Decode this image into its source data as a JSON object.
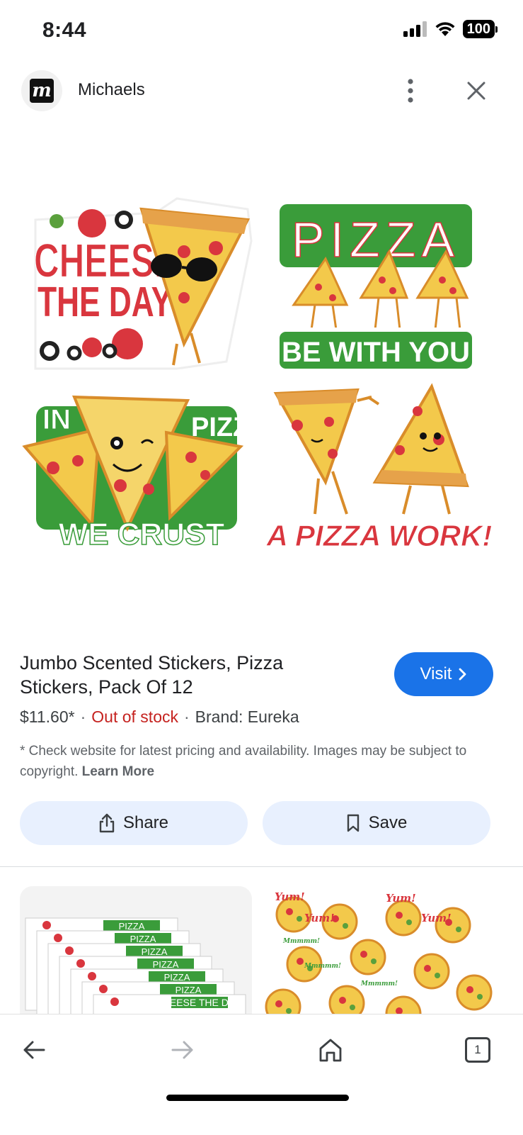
{
  "status_bar": {
    "time": "8:44",
    "battery": "100"
  },
  "header": {
    "site_name": "Michaels",
    "logo_letter": "m"
  },
  "hero": {
    "stickers": [
      {
        "lines": [
          "CHEESE",
          "THE DAY!"
        ],
        "color": "#d9363e"
      },
      {
        "top": "PIZZA",
        "bottom": "BE WITH YOU",
        "color": "#3a9c3a"
      },
      {
        "lines": [
          "IN",
          "PIZZA",
          "WE CRUST"
        ],
        "color": "#3a9c3a"
      },
      {
        "lines": [
          "A PIZZA WORK!"
        ],
        "color": "#d9363e"
      }
    ]
  },
  "product": {
    "title": "Jumbo Scented Stickers, Pizza Stickers, Pack Of 12",
    "price": "$11.60*",
    "stock": "Out of stock",
    "brand": "Brand: Eureka",
    "disclaimer": "* Check website for latest pricing and availability. Images may be subject to copyright.",
    "learn_more": "Learn More",
    "visit_label": "Visit"
  },
  "actions": {
    "share_label": "Share",
    "save_label": "Save"
  },
  "related": {
    "left_labels": [
      "PIZZA",
      "PIZZA",
      "PIZZA",
      "PIZZA",
      "PIZZA",
      "PIZZA",
      "CHEESE THE DAY!"
    ],
    "right_labels": [
      "Yum!",
      "Yum!",
      "Yum!",
      "Yum!",
      "Mmmmm!",
      "Mmmmm!",
      "Mmmmm!"
    ]
  },
  "nav": {
    "tab_count": "1"
  },
  "colors": {
    "accent": "#1a73e8",
    "out_of_stock": "#c5221f",
    "pill_bg": "#e8f0fe"
  }
}
